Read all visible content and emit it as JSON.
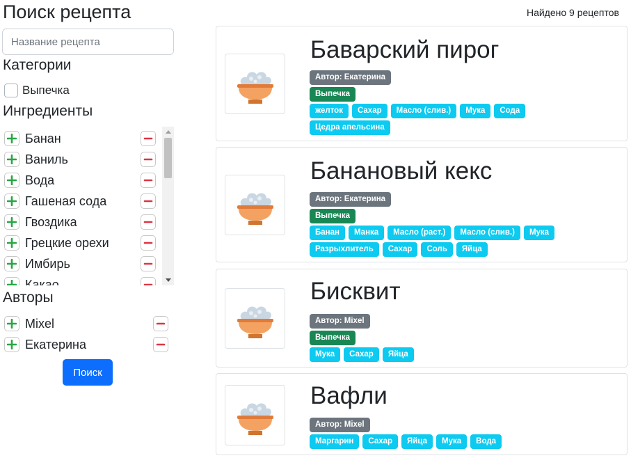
{
  "sidebar": {
    "title": "Поиск рецепта",
    "search_placeholder": "Название рецепта",
    "categories_heading": "Категории",
    "categories": [
      "Выпечка"
    ],
    "ingredients_heading": "Ингредиенты",
    "ingredients": [
      "Банан",
      "Ваниль",
      "Вода",
      "Гашеная сода",
      "Гвоздика",
      "Грецкие орехи",
      "Имбирь",
      "Какао"
    ],
    "authors_heading": "Авторы",
    "authors": [
      "Mixel",
      "Екатерина"
    ],
    "search_button": "Поиск"
  },
  "main": {
    "found_text": "Найдено 9 рецептов",
    "recipes": [
      {
        "title": "Баварский пирог",
        "author": "Автор: Екатерина",
        "category": "Выпечка",
        "ingredients": [
          "желток",
          "Сахар",
          "Масло (слив.)",
          "Мука",
          "Сода",
          "Цедра апельсина"
        ]
      },
      {
        "title": "Банановый кекс",
        "author": "Автор: Екатерина",
        "category": "Выпечка",
        "ingredients": [
          "Банан",
          "Манка",
          "Масло (раст.)",
          "Масло (слив.)",
          "Мука",
          "Разрыхлитель",
          "Сахар",
          "Соль",
          "Яйца"
        ]
      },
      {
        "title": "Бисквит",
        "author": "Автор: Mixel",
        "category": "Выпечка",
        "ingredients": [
          "Мука",
          "Сахар",
          "Яйца"
        ]
      },
      {
        "title": "Вафли",
        "author": "Автор: Mixel",
        "category": "",
        "ingredients": [
          "Маргарин",
          "Сахар",
          "Яйца",
          "Мука",
          "Вода"
        ]
      }
    ]
  },
  "colors": {
    "primary": "#0d6efd",
    "author_badge": "#6c757d",
    "category_badge": "#198754",
    "ingredient_badge": "#0dcaf0",
    "plus": "#28a745",
    "minus": "#dc3545"
  },
  "icons": {
    "add": "plus-icon",
    "remove": "minus-icon",
    "recipe": "rice-bowl-icon"
  }
}
